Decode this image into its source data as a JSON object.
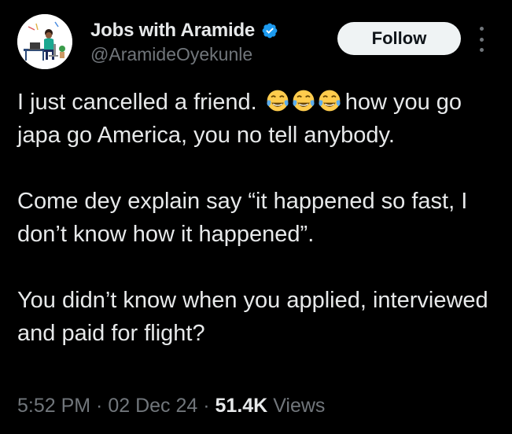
{
  "author": {
    "display_name": "Jobs with Aramide",
    "handle": "@AramideOyekunle",
    "verified": true,
    "avatar_icon": "person-at-laptop-avatar"
  },
  "actions": {
    "follow_label": "Follow",
    "more_icon": "more-vertical-icon"
  },
  "tweet": {
    "paragraphs": [
      {
        "before_emoji": "I just cancelled a friend.",
        "emojis": [
          "face-with-tears-of-joy",
          "face-with-tears-of-joy",
          "face-with-tears-of-joy"
        ],
        "after_emoji": "how you go japa go America, you no tell anybody."
      },
      {
        "text": "Come dey explain say “it happened so fast, I don’t know how it happened”."
      },
      {
        "text": "You didn’t know when you applied, interviewed and paid for flight?"
      }
    ]
  },
  "meta": {
    "time": "5:52 PM",
    "separator_1": " · ",
    "date": "02 Dec 24",
    "separator_2": " · ",
    "views_count": "51.4K",
    "views_label": "Views"
  },
  "colors": {
    "background": "#000000",
    "text_primary": "#e7e9ea",
    "text_secondary": "#71767b",
    "verified_badge": "#1d9bf0",
    "follow_button_bg": "#eff3f4",
    "follow_button_text": "#0f1419"
  }
}
